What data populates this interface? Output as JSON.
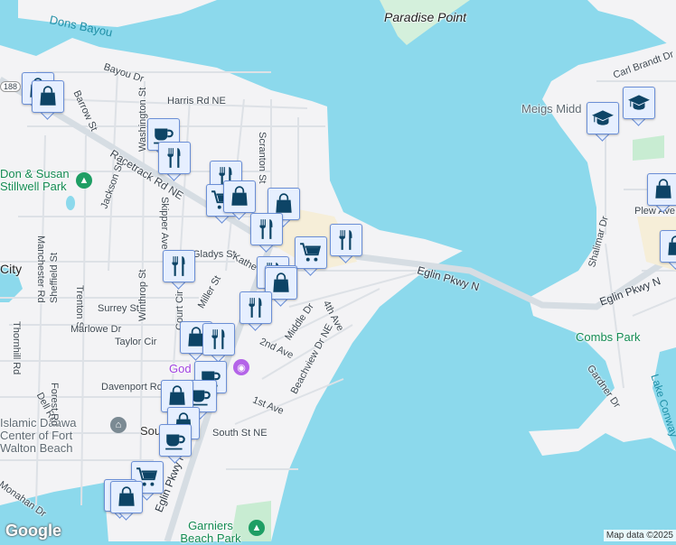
{
  "labels": {
    "water": [
      "Dons Bayou",
      "Lake Conway"
    ],
    "places": [
      "Paradise Point",
      "City"
    ],
    "parks": [
      "Don & Susan Stillwell Park",
      "Combs Park",
      "Garniers Beach Park"
    ],
    "pois": [
      "Meigs Midd",
      "Islamic Daawa Center of Fort Walton Beach",
      "God",
      "Sou"
    ],
    "roads": [
      "Bayou Dr",
      "Barrow St",
      "Harris Rd NE",
      "Washington St",
      "Racetrack Rd NE",
      "Scranton St",
      "Jackson St",
      "Skipper Ave",
      "Manchester Rd",
      "Gladys St",
      "Kathe",
      "Eglin Pkwy N",
      "Eglin Pkwy N",
      "Carl Brandt Dr",
      "Plew Ave",
      "Shalimar Dr",
      "Sheffield St",
      "Trenton St",
      "Winthrop St",
      "Surrey St",
      "Miller St",
      "Marlowe Dr",
      "Taylor Cir",
      "Thornhill Rd",
      "Middle Dr",
      "2nd Ave",
      "4th Ave",
      "Beachview Dr NE",
      "Davenport Rd",
      "1st Ave",
      "Dell Rd",
      "Forest Rd",
      "South St NE",
      "Monahan Dr",
      "Eglin Pkwy NE",
      "Gardner Dr",
      "Court Cir",
      "188"
    ]
  },
  "markers": [
    "shopping-bag",
    "shopping-bag",
    "coffee",
    "restaurant",
    "restaurant",
    "grocery-cart",
    "shopping-bag",
    "shopping-bag",
    "restaurant",
    "grocery-cart",
    "restaurant",
    "restaurant",
    "restaurant",
    "restaurant",
    "shopping-bag",
    "restaurant",
    "shopping-bag",
    "restaurant",
    "coffee",
    "coffee",
    "shopping-bag",
    "shopping-bag",
    "coffee",
    "grocery-cart",
    "shopping-bag",
    "shopping-bag",
    "school",
    "school",
    "shopping-bag",
    "shopping-bag"
  ],
  "attribution": "Map data ©2025",
  "logo": "Google",
  "colors": {
    "water": "#8cd9ec",
    "land": "#f3f3f5",
    "marker_fill": "#e6efff",
    "marker_icon": "#0d4466"
  }
}
